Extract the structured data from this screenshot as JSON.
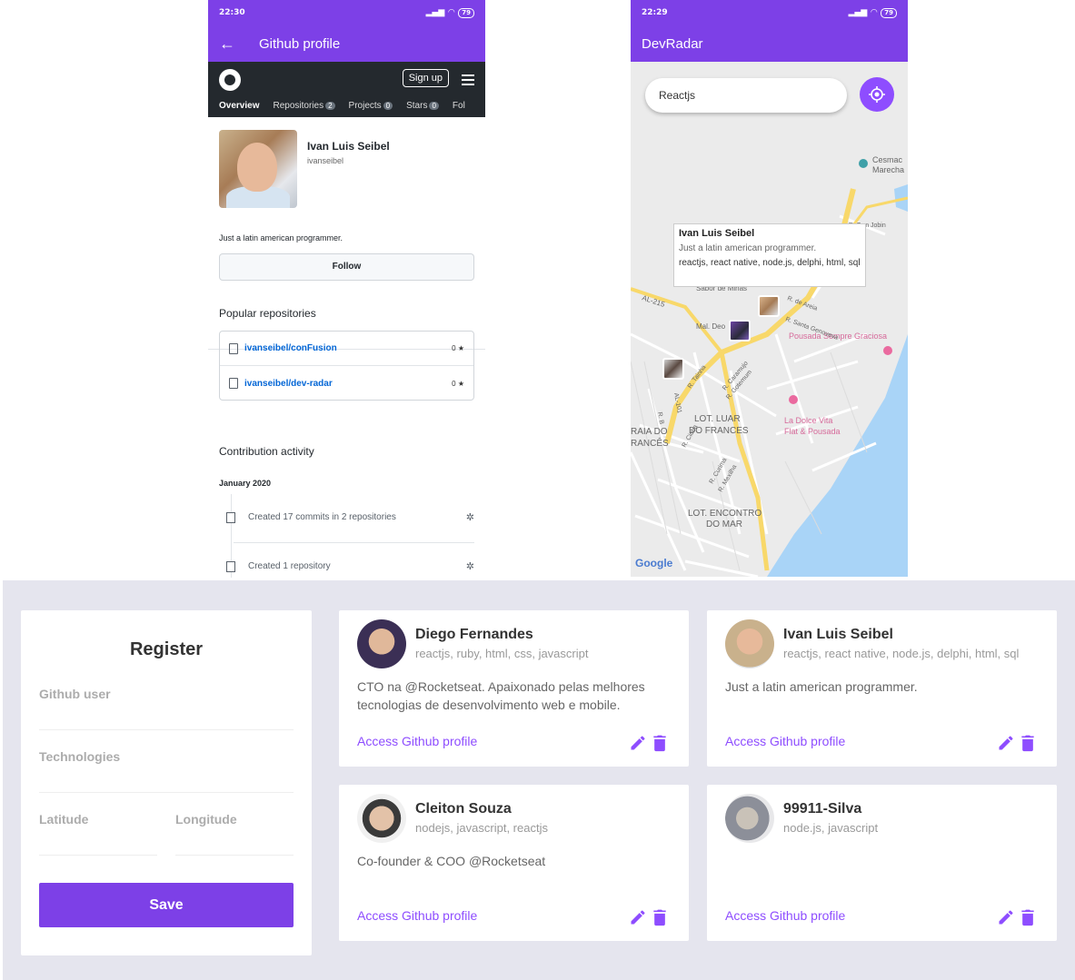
{
  "github_phone": {
    "status_time": "22:30",
    "battery": "79",
    "appbar_title": "Github profile",
    "signup_label": "Sign up",
    "tabs": [
      {
        "label": "Overview",
        "count": ""
      },
      {
        "label": "Repositories",
        "count": "2"
      },
      {
        "label": "Projects",
        "count": "0"
      },
      {
        "label": "Stars",
        "count": "0"
      },
      {
        "label": "Fol",
        "count": ""
      }
    ],
    "name": "Ivan Luis Seibel",
    "login": "ivanseibel",
    "bio": "Just a latin american programmer.",
    "follow_label": "Follow",
    "popular_title": "Popular repositories",
    "repos": [
      {
        "name": "ivanseibel/conFusion",
        "stars": "0 ★"
      },
      {
        "name": "ivanseibel/dev-radar",
        "stars": "0 ★"
      }
    ],
    "contribution_title": "Contribution activity",
    "month": "January 2020",
    "activities": [
      "Created 17 commits in 2 repositories",
      "Created 1 repository"
    ]
  },
  "map_phone": {
    "status_time": "22:29",
    "battery": "79",
    "appbar_title": "DevRadar",
    "search_value": "Reactjs",
    "callout": {
      "name": "Ivan Luis Seibel",
      "bio": "Just a latin american programmer.",
      "techs": "reactjs, react native, node.js, delphi, html, sql"
    },
    "map_labels": {
      "l1": "Cesmac",
      "l2": "Marecha",
      "l3": "R. Tom Jobin",
      "l4": "Sabor de Minas",
      "l5": "AL-215",
      "l6": "Mal. Deo",
      "l7": "Pousada Sempre Graciosa",
      "l8": "LOT. LUAR",
      "l9": "DO FRANCES",
      "l10": "RAIA DO",
      "l11": "RANCÊS",
      "l12": "La Dolce Vita",
      "l13": "Flat & Pousada",
      "l14": "LOT. ENCONTRO",
      "l15": "DO MAR",
      "l16": "AL-101",
      "l17": "R. Santa Genoveva",
      "l18": "R. de Areia",
      "l19": "R. Caramujo",
      "l20": "R. Gotemum",
      "l21": "R. Tainha",
      "l22": "R. Cioba",
      "l23": "R. Curima",
      "l24": "R. Mexilha",
      "l25": "R. B",
      "google": "Google"
    }
  },
  "web": {
    "register": {
      "title": "Register",
      "github_user_label": "Github user",
      "techs_label": "Technologies",
      "latitude_label": "Latitude",
      "longitude_label": "Longitude",
      "save_label": "Save"
    },
    "devs": [
      {
        "name": "Diego Fernandes",
        "techs": "reactjs, ruby, html, css, javascript",
        "bio": "CTO na @Rocketseat. Apaixonado pelas melhores tecnologias de desenvolvimento web e mobile.",
        "link": "Access Github profile"
      },
      {
        "name": "Ivan Luis Seibel",
        "techs": "reactjs, react native, node.js, delphi, html, sql",
        "bio": "Just a latin american programmer.",
        "link": "Access Github profile"
      },
      {
        "name": "Cleiton Souza",
        "techs": "nodejs, javascript, reactjs",
        "bio": "Co-founder & COO @Rocketseat",
        "link": "Access Github profile"
      },
      {
        "name": "99911-Silva",
        "techs": "node.js, javascript",
        "bio": "",
        "link": "Access Github profile"
      }
    ]
  },
  "colors": {
    "primary": "#7d40e7",
    "accent": "#8e4dff",
    "github_dark": "#24292e",
    "link_blue": "#0366d6",
    "web_bg": "#e5e5ee",
    "water": "#a9d4f7",
    "road_yellow": "#f8d86a"
  }
}
